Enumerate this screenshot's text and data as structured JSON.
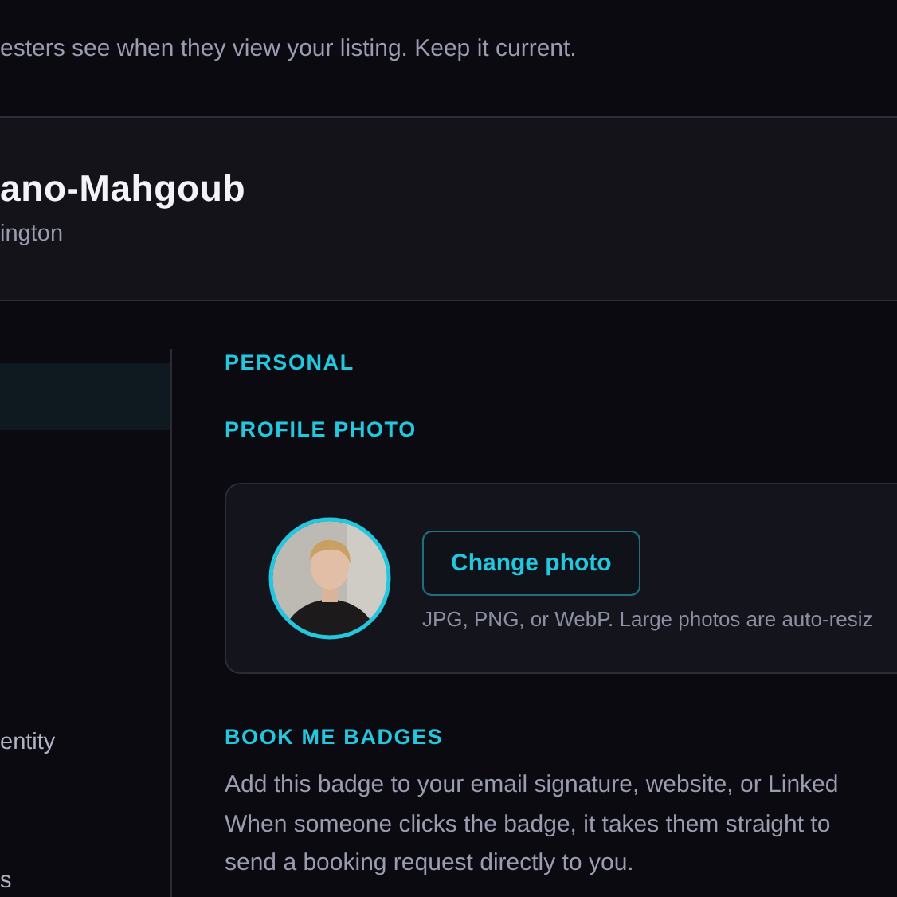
{
  "header": {
    "subtitle": "esters see when they view your listing. Keep it current."
  },
  "profile_card": {
    "name": "ano-Mahgoub",
    "location": "ington"
  },
  "sidebar": {
    "items": [
      {
        "selected": true
      },
      {
        "label": "entity",
        "selected": false
      },
      {
        "label": "s",
        "selected": false
      }
    ]
  },
  "personal_heading": "PERSONAL",
  "photo_section": {
    "title": "PROFILE PHOTO",
    "button": "Change photo",
    "hint": "JPG, PNG, or WebP. Large photos are auto-resiz"
  },
  "badges_section": {
    "title": "BOOK ME BADGES",
    "lines": [
      "Add this badge to your email signature, website, or Linked",
      "When someone clicks the badge, it takes them straight to",
      "send a booking request directly to you."
    ]
  }
}
